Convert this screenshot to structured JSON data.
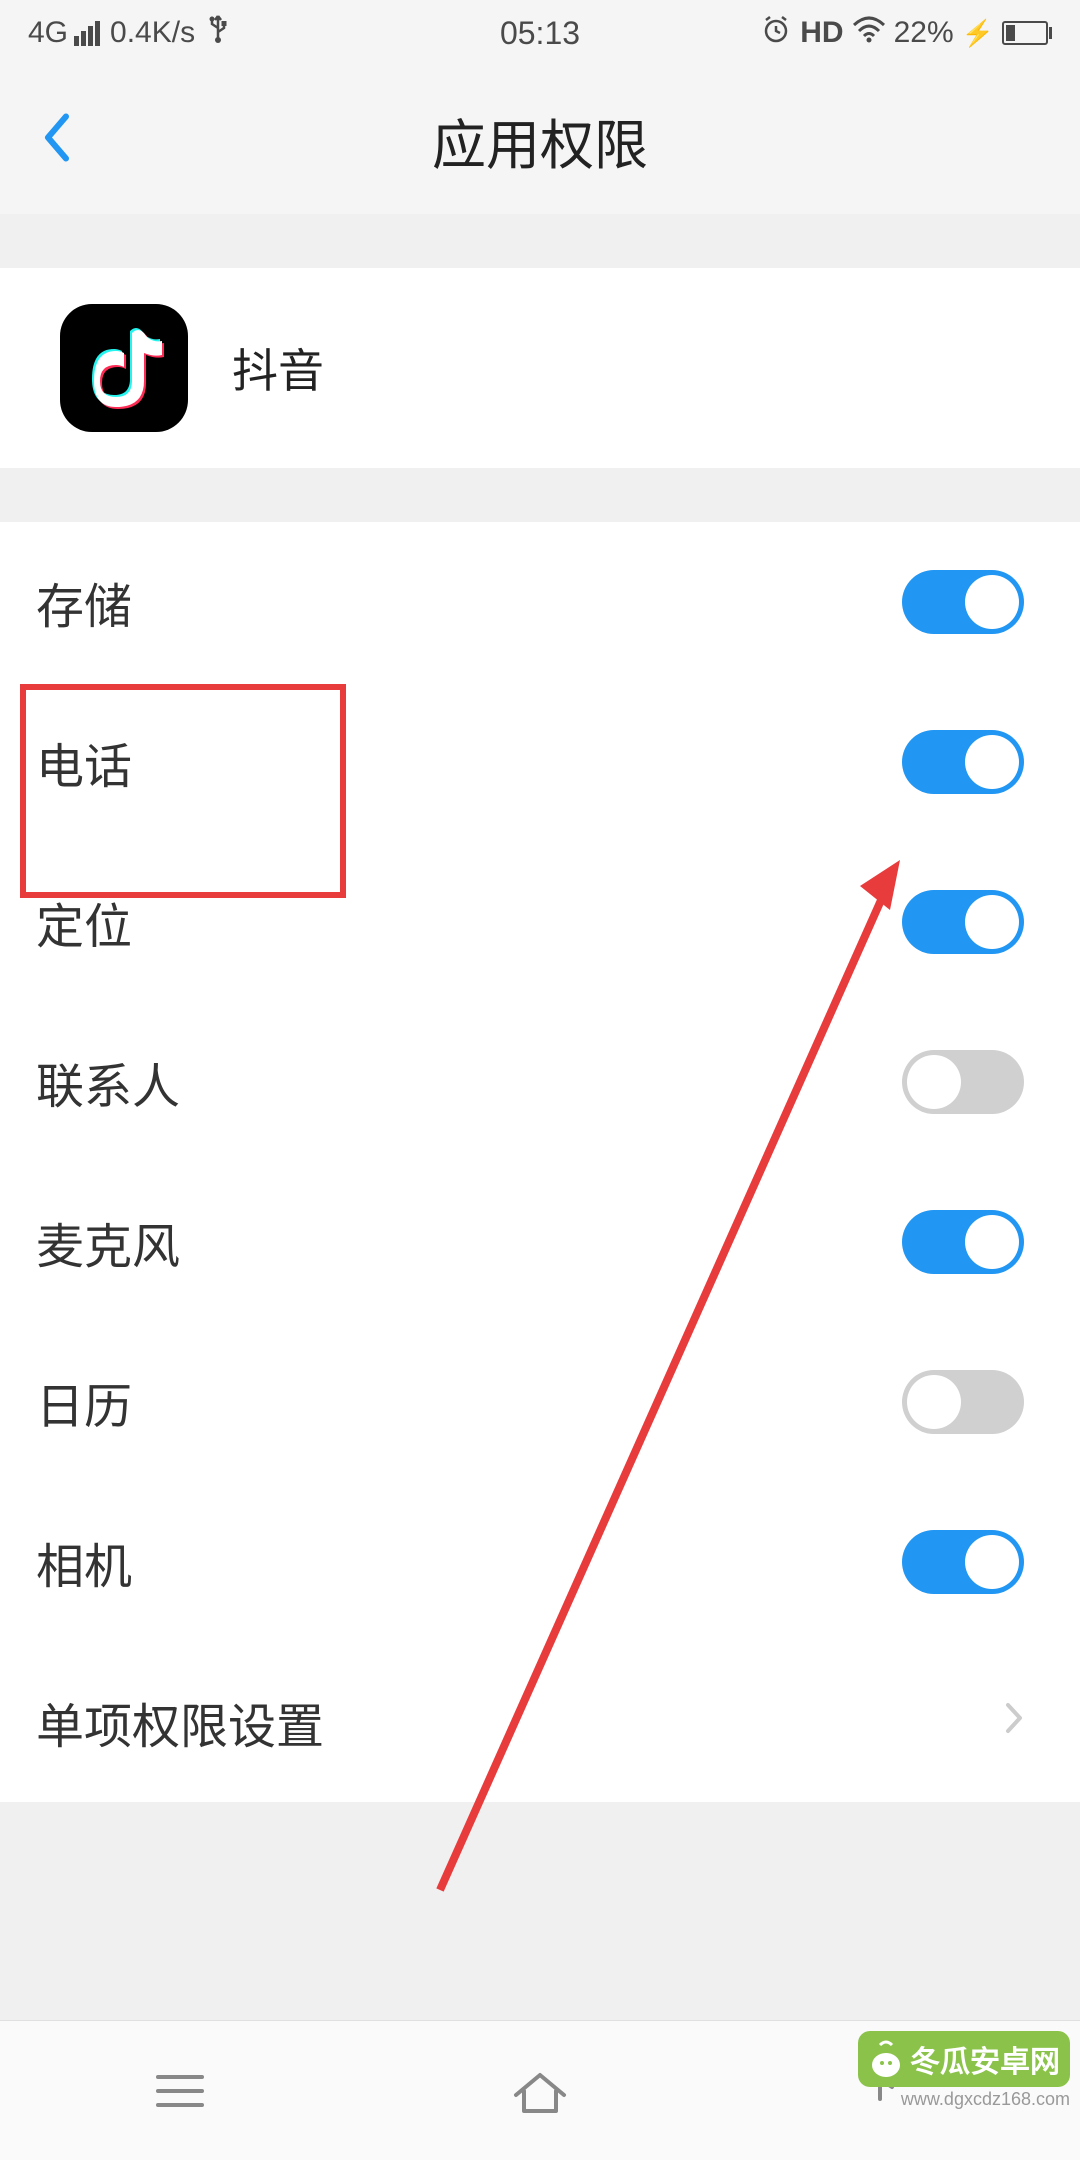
{
  "status_bar": {
    "network": "4G",
    "speed": "0.4K/s",
    "time": "05:13",
    "hd": "HD",
    "battery_percent": "22%"
  },
  "header": {
    "title": "应用权限"
  },
  "app": {
    "name": "抖音"
  },
  "permissions": [
    {
      "label": "存储",
      "enabled": true
    },
    {
      "label": "电话",
      "enabled": true
    },
    {
      "label": "定位",
      "enabled": true
    },
    {
      "label": "联系人",
      "enabled": false
    },
    {
      "label": "麦克风",
      "enabled": true
    },
    {
      "label": "日历",
      "enabled": false
    },
    {
      "label": "相机",
      "enabled": true
    }
  ],
  "link": {
    "label": "单项权限设置"
  },
  "annotation": {
    "highlighted_permission": "电话"
  },
  "watermark": {
    "text": "冬瓜安卓网",
    "url": "www.dgxcdz168.com"
  },
  "colors": {
    "accent": "#2196f3",
    "highlight": "#e83c3c"
  }
}
